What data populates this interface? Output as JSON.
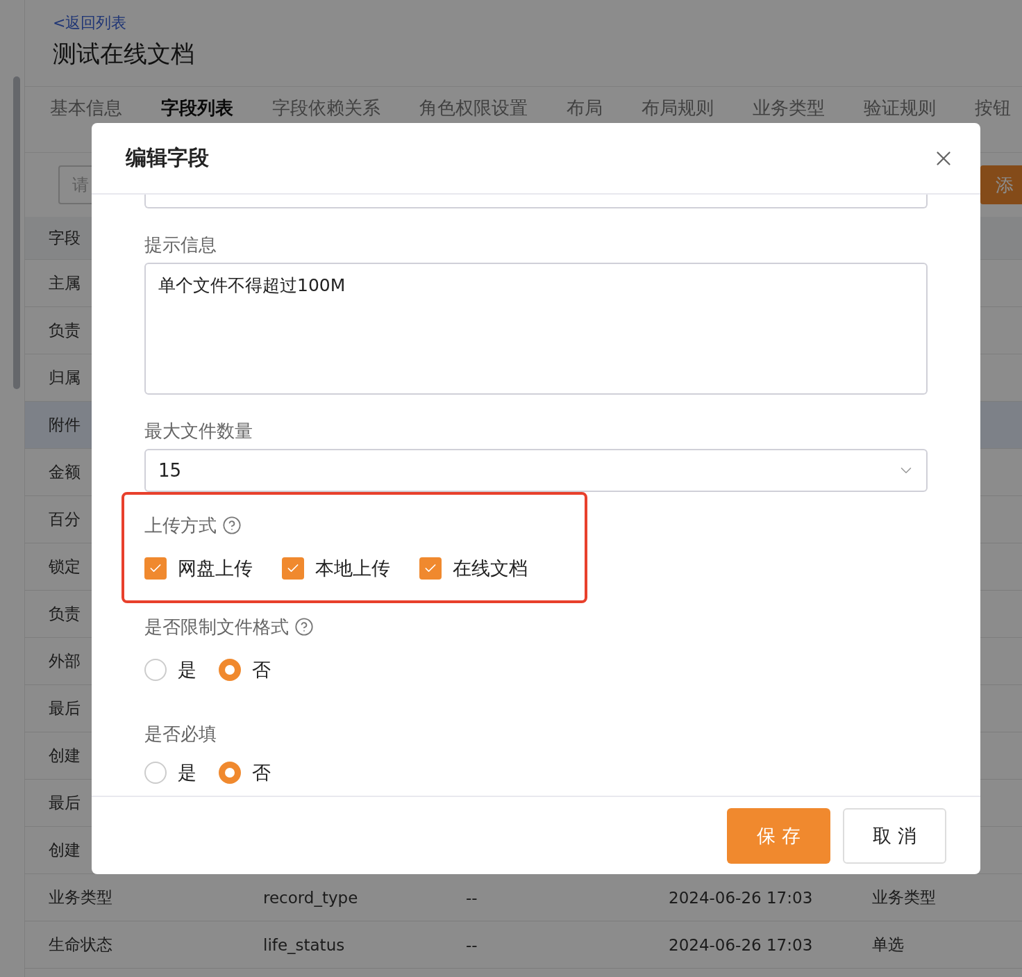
{
  "page": {
    "back_link": "<返回列表",
    "title": "测试在线文档"
  },
  "tabs": [
    {
      "label": "基本信息",
      "selected": false
    },
    {
      "label": "字段列表",
      "selected": true
    },
    {
      "label": "字段依赖关系",
      "selected": false
    },
    {
      "label": "角色权限设置",
      "selected": false
    },
    {
      "label": "布局",
      "selected": false
    },
    {
      "label": "布局规则",
      "selected": false
    },
    {
      "label": "业务类型",
      "selected": false
    },
    {
      "label": "验证规则",
      "selected": false
    },
    {
      "label": "按钮",
      "selected": false
    }
  ],
  "search": {
    "placeholder": "请"
  },
  "add_button": "添",
  "table": {
    "header": [
      "字段"
    ],
    "rows": [
      {
        "cells": [
          "主属"
        ],
        "selected": false
      },
      {
        "cells": [
          "负责"
        ],
        "selected": false
      },
      {
        "cells": [
          "归属"
        ],
        "selected": false
      },
      {
        "cells": [
          "附件"
        ],
        "selected": true
      },
      {
        "cells": [
          "金额"
        ],
        "selected": false
      },
      {
        "cells": [
          "百分"
        ],
        "selected": false
      },
      {
        "cells": [
          "锁定"
        ],
        "selected": false
      },
      {
        "cells": [
          "负责"
        ],
        "selected": false
      },
      {
        "cells": [
          "外部"
        ],
        "selected": false
      },
      {
        "cells": [
          "最后"
        ],
        "selected": false
      },
      {
        "cells": [
          "创建"
        ],
        "selected": false
      },
      {
        "cells": [
          "最后"
        ],
        "selected": false
      },
      {
        "cells": [
          "创建"
        ],
        "selected": false
      },
      {
        "cells": [
          "业务类型",
          "record_type",
          "--",
          "2024-06-26 17:03",
          "业务类型"
        ],
        "selected": false
      },
      {
        "cells": [
          "生命状态",
          "life_status",
          "--",
          "2024-06-26 17:03",
          "单选"
        ],
        "selected": false
      }
    ]
  },
  "dialog": {
    "title": "编辑字段",
    "hint": {
      "label": "提示信息",
      "value": "单个文件不得超过100M"
    },
    "max_files": {
      "label": "最大文件数量",
      "value": "15"
    },
    "upload": {
      "label": "上传方式",
      "highlighted": true,
      "options": [
        {
          "label": "网盘上传",
          "checked": true
        },
        {
          "label": "本地上传",
          "checked": true
        },
        {
          "label": "在线文档",
          "checked": true
        }
      ]
    },
    "format_limit": {
      "label": "是否限制文件格式",
      "options": [
        {
          "label": "是",
          "selected": false
        },
        {
          "label": "否",
          "selected": true
        }
      ]
    },
    "required": {
      "label": "是否必填",
      "options": [
        {
          "label": "是",
          "selected": false
        },
        {
          "label": "否",
          "selected": true
        }
      ]
    },
    "buttons": [
      {
        "label": "保 存",
        "kind": "primary"
      },
      {
        "label": "取 消",
        "kind": "default"
      }
    ]
  }
}
